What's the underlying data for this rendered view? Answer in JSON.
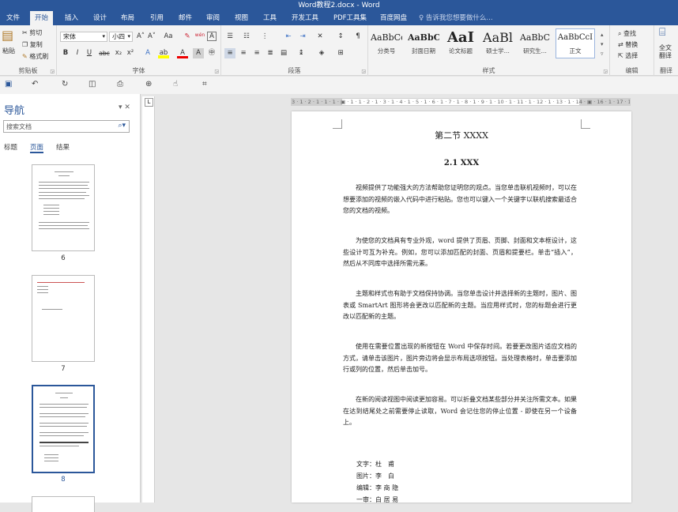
{
  "title": "Word教程2.docx - Word",
  "tabs": [
    "文件",
    "开始",
    "插入",
    "设计",
    "布局",
    "引用",
    "邮件",
    "审阅",
    "视图",
    "工具",
    "开发工具",
    "PDF工具集",
    "百度网盘"
  ],
  "tellme": "♀ 告诉我您想要做什么...",
  "clipboard": {
    "paste": "粘贴",
    "cut": "剪切",
    "copy": "复制",
    "painter": "格式刷",
    "label": "剪贴板"
  },
  "font": {
    "name": "宋体",
    "size": "小四",
    "grow": "A˄",
    "shrink": "A˅",
    "case": "Aa",
    "clear": "✎",
    "pinyin": "wén",
    "border": "A",
    "bold": "B",
    "italic": "I",
    "underline": "U",
    "strike": "abc",
    "sub": "x₂",
    "sup": "x²",
    "effects": "A",
    "highlight": "ab",
    "color": "A",
    "shade": "A",
    "circle": "㊥",
    "label": "字体"
  },
  "paragraph": {
    "label": "段落"
  },
  "styles": {
    "items": [
      {
        "sample": "AaBbCc",
        "name": "分类号"
      },
      {
        "sample": "AaBbC",
        "name": "封面日期"
      },
      {
        "sample": "AaI",
        "name": "论文标题"
      },
      {
        "sample": "AaBl",
        "name": "硕士学..."
      },
      {
        "sample": "AaBbC",
        "name": "研究生..."
      },
      {
        "sample": "AaBbCcI",
        "name": "正文"
      }
    ],
    "label": "样式"
  },
  "editing": {
    "find": "查找",
    "replace": "替换",
    "select": "选择",
    "label": "编辑"
  },
  "translate": {
    "btn": "全文翻译",
    "label": "翻译"
  },
  "nav": {
    "title": "导航",
    "search": "搜索文档",
    "tabs": [
      "标题",
      "页面",
      "结果"
    ],
    "pages": [
      "6",
      "7",
      "8"
    ]
  },
  "ruler": "3 · 1 · 2 · 1 · 1 · 1 · ▣ · 1 · 1 · 2 · 1 · 3 · 1 · 4 · 1 · 5 · 1 · 6 · 1 · 7 · 1 · 8 · 1 · 9 · 1 · 10 · 1 · 11 · 1 · 12 · 1 · 13 · 1 · 14 · ▣ · 16 · 1 · 17 · 1",
  "doc": {
    "heading1": "第二节 XXXX",
    "heading2": "2.1 XXX",
    "paragraphs": [
      "视频提供了功能强大的方法帮助您证明您的观点。当您单击联机视频时，可以在想要添加的视频的嵌入代码中进行粘贴。您也可以键入一个关键字以联机搜索最适合您的文档的视频。",
      "为使您的文档具有专业外观，word 提供了页眉、页脚、封面和文本框设计，这些设计可互为补充。例如，您可以添加匹配的封面、页眉和提要栏。单击“插入”，然后从不同库中选择所需元素。",
      "主题和样式也有助于文档保持协调。当您单击设计并选择新的主题时，图片、图表或 SmartArt 图形将会更改以匹配新的主题。当应用样式时，您的标题会进行更改以匹配新的主题。",
      "使用在需要位置出现的新按钮在 Word 中保存时间。若要更改图片适应文档的方式，请单击该图片，图片旁边将会显示布局选项按钮。当处理表格时，单击要添加行或列的位置，然后单击加号。",
      "在新的阅读视图中阅读更加容易。可以折叠文档某些部分并关注所需文本。如果在达到结尾处之前需要停止读取，Word 会记住您的停止位置 - 即使在另一个设备上。"
    ],
    "credits": [
      "文字：杜　甫",
      "图片：李　白",
      "编辑：李 商 隐",
      "一审：白 居 易"
    ]
  }
}
